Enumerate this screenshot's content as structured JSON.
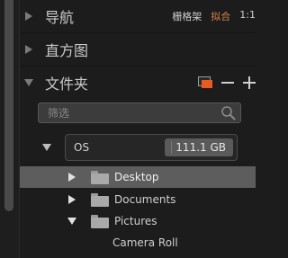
{
  "navigator": {
    "title": "导航",
    "options": [
      "栅格架",
      "拟合",
      "1:1"
    ],
    "active_option": "拟合"
  },
  "histogram": {
    "title": "直方图"
  },
  "folders": {
    "title": "文件夹",
    "minus_label": "−",
    "plus_label": "+",
    "search_placeholder": "筛选",
    "volume": {
      "name": "OS",
      "size": "111.1 GB"
    },
    "tree": [
      {
        "label": "Desktop",
        "expand": "collapsed",
        "selected": true
      },
      {
        "label": "Documents",
        "expand": "collapsed",
        "selected": false
      },
      {
        "label": "Pictures",
        "expand": "expanded",
        "selected": false
      },
      {
        "label": "Camera Roll",
        "expand": "none",
        "selected": false
      }
    ]
  },
  "colors": {
    "accent": "#d9824f",
    "icon_orange": "#e85a1e"
  }
}
